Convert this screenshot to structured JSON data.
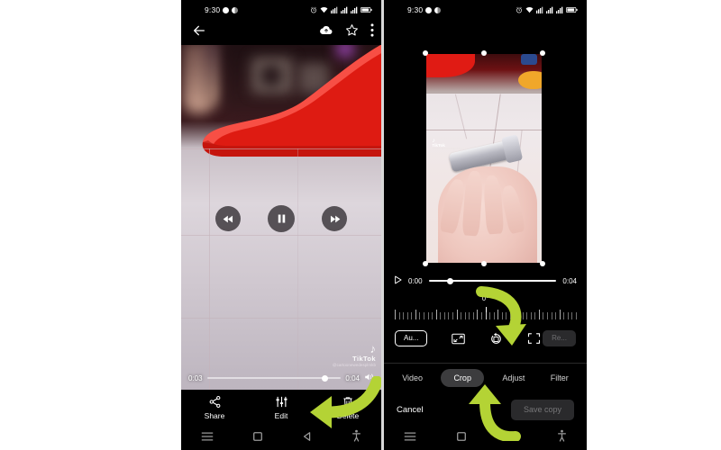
{
  "left_phone": {
    "status_bar": {
      "time": "9:30",
      "left_icons": [
        "dot-icon",
        "half-moon-icon"
      ],
      "right_icons": [
        "alarm-icon",
        "wifi-icon",
        "signal-icon",
        "signal-bars-icon",
        "signal-bars-2-icon",
        "battery-icon"
      ]
    },
    "top_bar": {
      "back_icon": "back-arrow-icon",
      "cloud_icon": "cloud-upload-icon",
      "star_icon": "star-icon",
      "more_icon": "more-vertical-icon"
    },
    "player": {
      "rewind_icon": "rewind-icon",
      "pause_icon": "pause-icon",
      "forward_icon": "fast-forward-icon",
      "current_time": "0:03",
      "total_time": "0:04",
      "volume_icon": "volume-icon",
      "progress_percent": 88
    },
    "watermark": {
      "note_glyph": "♪",
      "brand": "TikTok",
      "username": "@cartoonewedesplmkb"
    },
    "actions": [
      {
        "label": "Share",
        "icon": "share-icon"
      },
      {
        "label": "Edit",
        "icon": "edit-sliders-icon"
      },
      {
        "label": "Delete",
        "icon": "trash-icon"
      }
    ],
    "nav_bar": [
      "menu-icon",
      "home-square-icon",
      "back-triangle-icon",
      "accessibility-icon"
    ]
  },
  "right_phone": {
    "status_bar": {
      "time": "9:30",
      "left_icons": [
        "dot-icon",
        "half-moon-icon"
      ],
      "right_icons": [
        "alarm-icon",
        "wifi-icon",
        "signal-icon",
        "signal-bars-icon",
        "signal-bars-2-icon",
        "battery-icon"
      ]
    },
    "crop_preview": {
      "watermark_brand": "TikTok",
      "watermark_user": "@cartoonewedesplmkb",
      "handles": 6
    },
    "player": {
      "play_icon": "play-icon",
      "current_time": "0:00",
      "total_time": "0:04",
      "progress_percent": 17
    },
    "rotation": {
      "degree_label": "0°",
      "ruler_ticks": 45
    },
    "tools": [
      {
        "label": "Au...",
        "name": "auto-button",
        "style": "outlined"
      },
      {
        "label": "",
        "name": "aspect-ratio-icon",
        "style": "icon"
      },
      {
        "label": "",
        "name": "rotate-icon",
        "style": "icon"
      },
      {
        "label": "",
        "name": "free-crop-icon",
        "style": "icon"
      },
      {
        "label": "Re...",
        "name": "reset-button",
        "style": "dimmed"
      }
    ],
    "tabs": [
      {
        "label": "Video",
        "active": false
      },
      {
        "label": "Crop",
        "active": true
      },
      {
        "label": "Adjust",
        "active": false
      },
      {
        "label": "Filter",
        "active": false
      }
    ],
    "footer": {
      "cancel_label": "Cancel",
      "save_label": "Save copy"
    },
    "nav_bar": [
      "menu-icon",
      "home-square-icon",
      "back-triangle-icon",
      "accessibility-icon"
    ]
  },
  "annotations": {
    "arrow_color": "#b4d335",
    "arrow_left_target": "Edit",
    "arrow_right_top_target": "rotate-icon",
    "arrow_right_bottom_target": "Crop"
  }
}
